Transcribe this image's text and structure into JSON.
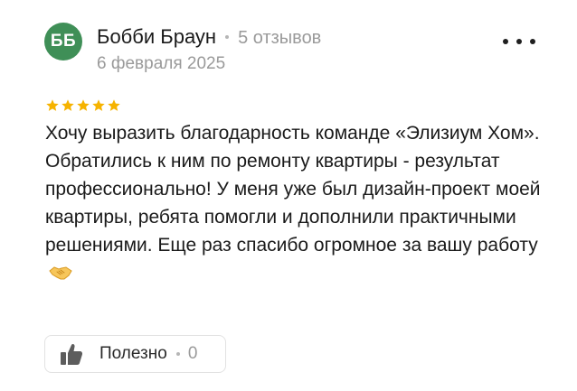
{
  "review": {
    "avatar_initials": "ББ",
    "avatar_color": "#3f8f57",
    "author_name": "Бобби Браун",
    "review_count": "5 отзывов",
    "date": "6 февраля 2025",
    "more_icon": "more-horizontal-icon",
    "rating": 5,
    "rating_max": 5,
    "star_color": "#f6b300",
    "text": "Хочу выразить благодарность команде «Элизиум Хом». Обратились к ним по ремонту квартиры - результат профессионально! У меня уже был дизайн-проект моей квартиры, ребята помогли и дополнили практичными решениями. Еще раз спасибо огромное за вашу работу",
    "text_emoji": "handshake-emoji",
    "helpful": {
      "label": "Полезно",
      "count": "0",
      "icon": "thumbs-up-icon"
    }
  }
}
